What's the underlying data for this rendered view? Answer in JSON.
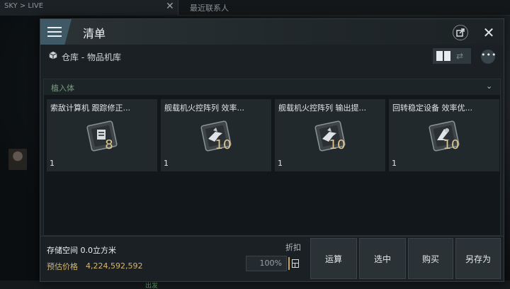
{
  "background": {
    "tab_text": "SKY > LIVE",
    "contacts_text": "最近联系人",
    "bottom_text": "出发"
  },
  "window": {
    "title": "清单",
    "breadcrumb": "仓库 - 物品机库",
    "view_toggle_icon": "grid-view-icon",
    "more_label": "•••"
  },
  "group": {
    "label": "植入体",
    "state": "expanded"
  },
  "items": [
    {
      "name": "索敌计算机 跟踪修正...",
      "count": "1",
      "level": "8",
      "icon": "cpu-module-icon"
    },
    {
      "name": "舰载机火控阵列 效率...",
      "count": "1",
      "level": "10",
      "icon": "drone-module-icon"
    },
    {
      "name": "舰载机火控阵列 输出提...",
      "count": "1",
      "level": "10",
      "icon": "drone-module-icon"
    },
    {
      "name": "回转稳定设备 效率优...",
      "count": "1",
      "level": "10",
      "icon": "gyro-module-icon"
    }
  ],
  "footer": {
    "storage_text": "存储空间 0.0立方米",
    "price_label": "预估价格",
    "price_value": "4,224,592,592",
    "discount_label": "折扣",
    "discount_value": "100%",
    "buttons": {
      "calc": "运算",
      "select": "选中",
      "buy": "购买",
      "saveas": "另存为"
    }
  },
  "colors": {
    "accent": "#3f5a66",
    "price": "#d7b66e",
    "level_number": "#e3c98e",
    "group_label": "#7c9a7f"
  }
}
